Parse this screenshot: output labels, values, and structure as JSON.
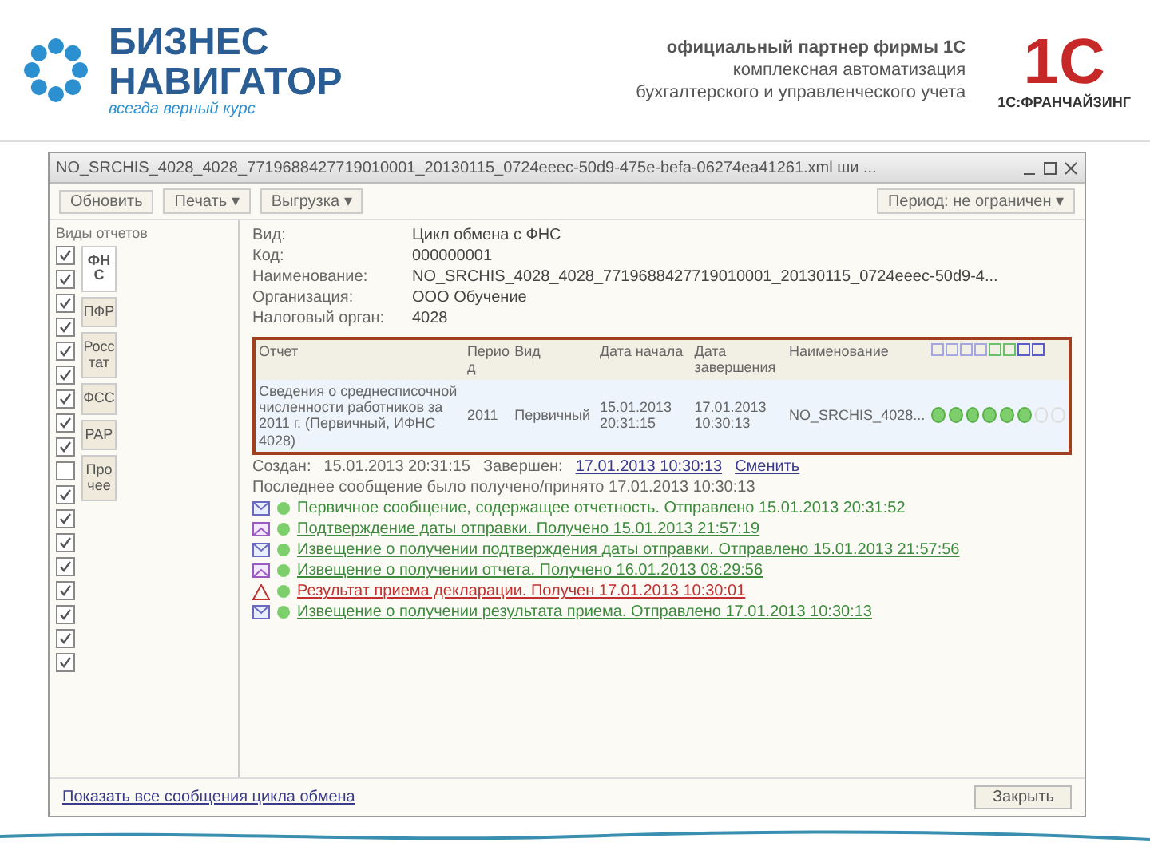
{
  "header": {
    "brand_line1": "БИЗНЕС",
    "brand_line2": "НАВИГАТОР",
    "tagline": "всегда верный курс",
    "partner_lines": [
      "официальный партнер фирмы 1С",
      "комплексная автоматизация",
      "бухгалтерского и управленческого учета"
    ],
    "logo_text": "1С",
    "franchise": "1С:ФРАНЧАЙЗИНГ"
  },
  "window": {
    "title": "NO_SRCHIS_4028_4028_7719688427719010001_20130115_0724eeec-50d9-475e-befa-06274ea41261.xml ши ..."
  },
  "toolbar": [
    {
      "label": "Обновить"
    },
    {
      "label": "Печать ▾"
    },
    {
      "label": "Выгрузка ▾"
    }
  ],
  "period": "Период: не ограничен ▾",
  "sidebar": {
    "title": "Виды отчетов",
    "tabs": [
      {
        "label": "ФНС",
        "selected": true
      },
      {
        "label": "ПФР",
        "selected": false
      },
      {
        "label": "Росстат",
        "selected": false
      },
      {
        "label": "ФСС",
        "selected": false
      },
      {
        "label": "РАР",
        "selected": false
      },
      {
        "label": "Прочее",
        "selected": false
      }
    ],
    "checks": [
      {
        "checked": true
      },
      {
        "checked": true
      },
      {
        "checked": true
      },
      {
        "checked": true
      },
      {
        "checked": true
      },
      {
        "checked": true
      },
      {
        "checked": true
      },
      {
        "checked": true
      },
      {
        "checked": true
      },
      {
        "checked": false
      },
      {
        "checked": true
      },
      {
        "checked": true
      },
      {
        "checked": true
      },
      {
        "checked": true
      },
      {
        "checked": true
      },
      {
        "checked": true
      },
      {
        "checked": true
      },
      {
        "checked": true
      }
    ]
  },
  "form": [
    {
      "label": "Вид:",
      "value": "Цикл обмена с ФНС"
    },
    {
      "label": "Код:",
      "value": "000000001"
    },
    {
      "label": "Наименование:",
      "value": "NO_SRCHIS_4028_4028_7719688427719010001_20130115_0724eeec-50d9-4..."
    },
    {
      "label": "Организация:",
      "value": "ООО Обучение"
    },
    {
      "label": "Налоговый орган:",
      "value": "4028"
    }
  ],
  "table": {
    "columns": [
      "Отчет",
      "Период",
      "Вид",
      "Дата начала",
      "Дата завершения",
      "Наименование"
    ],
    "rows": [
      {
        "selected": true,
        "cells": [
          "Сведения о среднесписочной численности работников за 2011 г. (Первичный, ИФНС 4028)",
          "2011",
          "Первичный",
          "15.01.2013 20:31:15",
          "17.01.2013 10:30:13",
          "NO_SRCHIS_4028..."
        ],
        "statuses": [
          {
            "done": true
          },
          {
            "done": true
          },
          {
            "done": true
          },
          {
            "done": true
          },
          {
            "done": true
          },
          {
            "done": true
          },
          {
            "done": false
          },
          {
            "done": false
          }
        ]
      }
    ]
  },
  "cycle": {
    "created_label": "Создан:",
    "created": "15.01.2013 20:31:15",
    "finished_label": "Завершен:",
    "finished": "17.01.2013 10:30:13",
    "change_link": "Сменить",
    "last_message": "Последнее сообщение было получено/принято 17.01.2013 10:30:13"
  },
  "messages": [
    {
      "kind": "sent",
      "link": false,
      "text": "Первичное сообщение, содержащее отчетность. Отправлено 15.01.2013 20:31:52"
    },
    {
      "kind": "received",
      "link": true,
      "text": "Подтверждение даты отправки. Получено 15.01.2013 21:57:19"
    },
    {
      "kind": "sent",
      "link": true,
      "text": "Извещение о получении подтверждения даты отправки. Отправлено 15.01.2013 21:57:56"
    },
    {
      "kind": "received",
      "link": true,
      "text": "Извещение о получении отчета. Получено 16.01.2013 08:29:56"
    },
    {
      "kind": "error",
      "link": true,
      "text": "Результат приема декларации. Получен 17.01.2013 10:30:01"
    },
    {
      "kind": "sent",
      "link": true,
      "text": "Извещение о получении результата приема. Отправлено 17.01.2013 10:30:13"
    }
  ],
  "show_all_link": "Показать все сообщения цикла обмена",
  "close_button": "Закрыть"
}
